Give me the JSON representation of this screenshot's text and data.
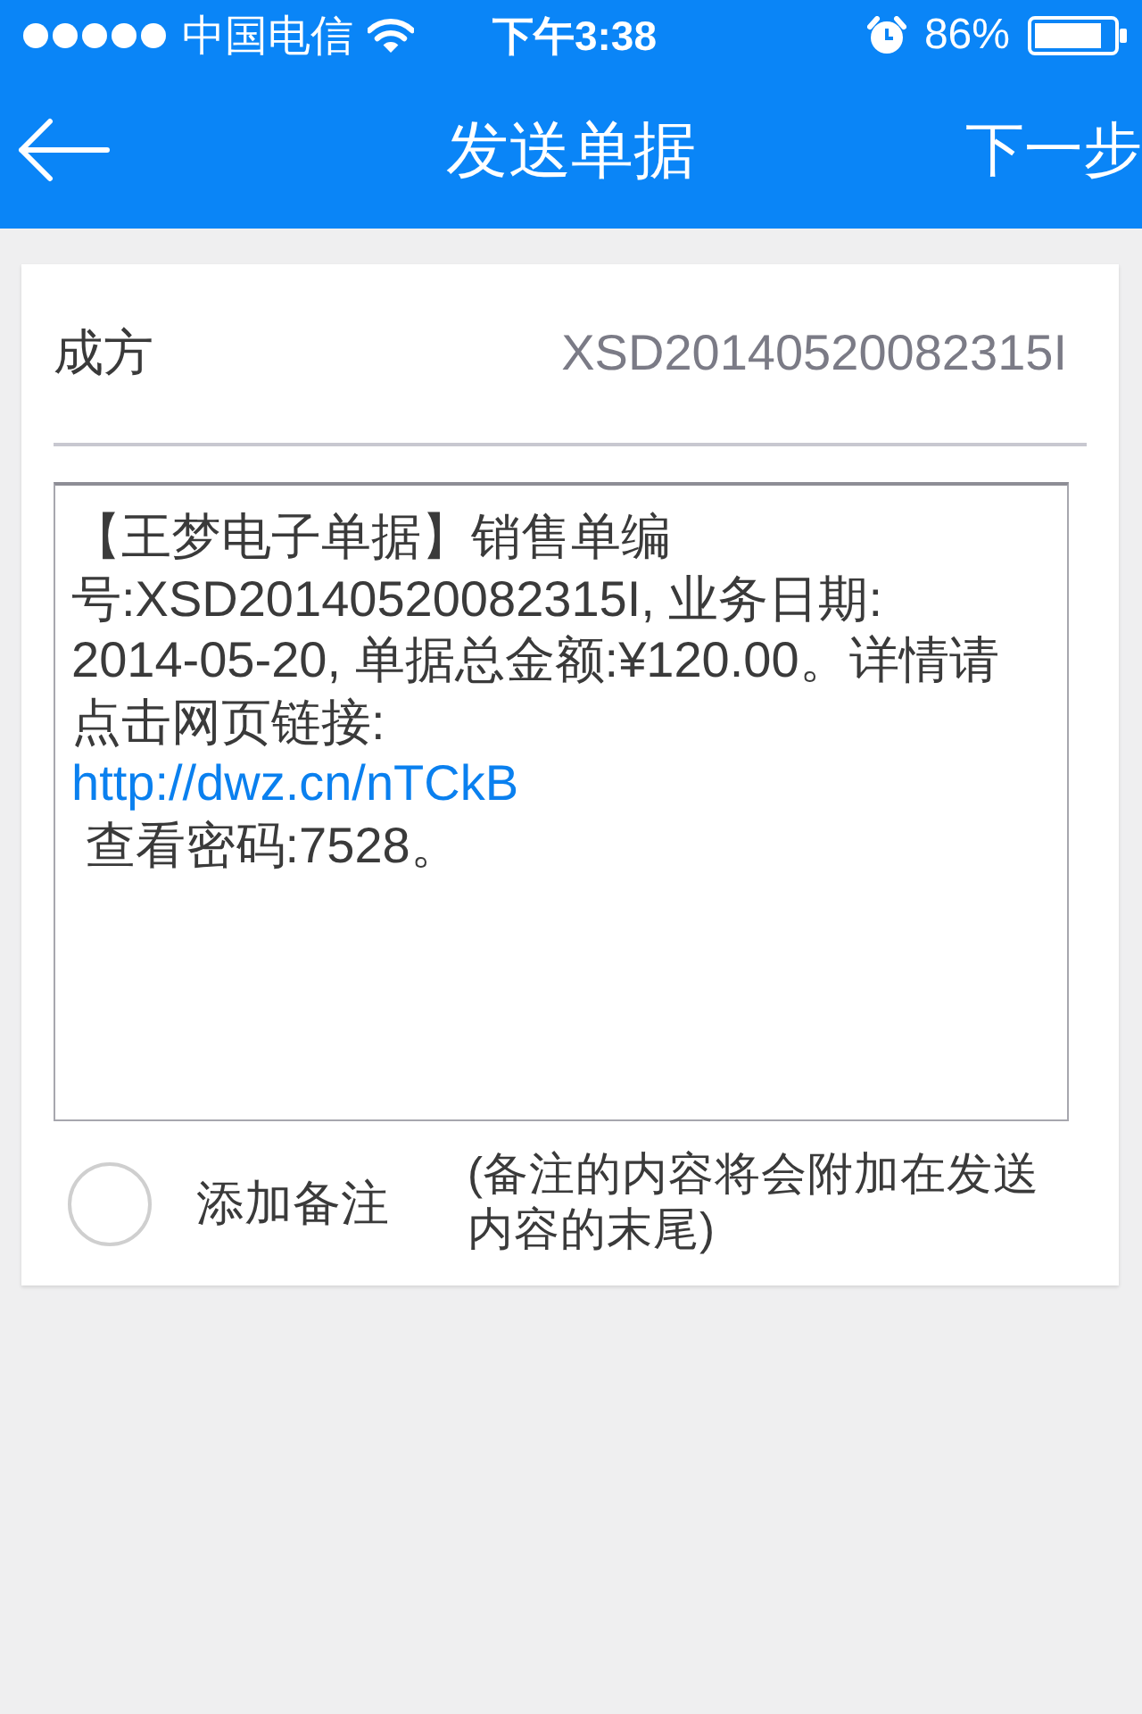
{
  "status_bar": {
    "carrier": "中国电信",
    "time": "下午3:38",
    "battery": "86%"
  },
  "nav_bar": {
    "title": "发送单据",
    "next": "下一步"
  },
  "recipient": {
    "label": "成方",
    "value": "XSD20140520082315I"
  },
  "message": {
    "parts": [
      {
        "kind": "text",
        "text": "【王梦电子单据】销售单编号:XSD20140520082315I, 业务日期:"
      },
      {
        "kind": "text",
        "text": "2014-05-20, 单据总金额:¥120.00。详情请点击网页链接:"
      },
      {
        "kind": "link",
        "text": "http://dwz.cn/nTCkB"
      },
      {
        "kind": "text",
        "text": " 查看密码:7528。"
      }
    ]
  },
  "note": {
    "checked": false,
    "label": "添加备注",
    "hint": "(备注的内容将会附加在发送内容的末尾)"
  }
}
